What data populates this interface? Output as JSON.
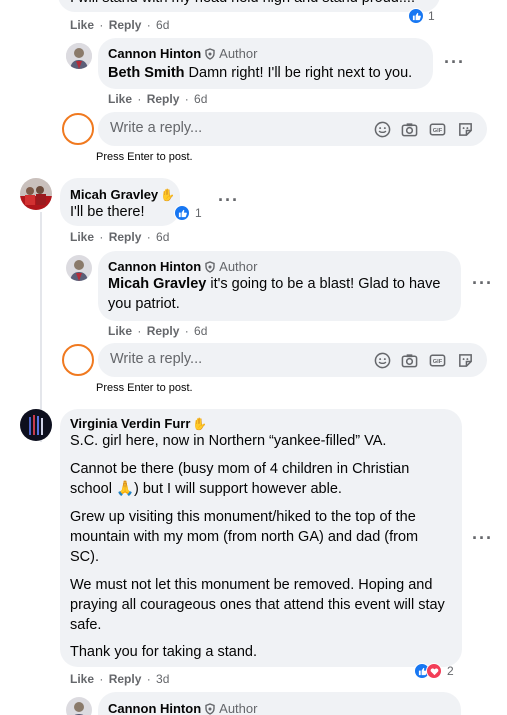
{
  "top_comment": {
    "text_partial": "I will stand with my head held high and stand proud....",
    "reaction_count": "1",
    "actions": {
      "like": "Like",
      "reply": "Reply",
      "time": "6d"
    }
  },
  "reply_1": {
    "author": "Cannon Hinton",
    "badge": "Author",
    "mention": "Beth Smith",
    "text": " Damn right! I'll be right next to you.",
    "actions": {
      "like": "Like",
      "reply": "Reply",
      "time": "6d"
    }
  },
  "reply_box_1": {
    "placeholder": "Write a reply...",
    "hint": "Press Enter to post."
  },
  "comment_micah": {
    "author": "Micah Gravley",
    "text": "I'll be there!",
    "reaction_count": "1",
    "actions": {
      "like": "Like",
      "reply": "Reply",
      "time": "6d"
    }
  },
  "reply_2": {
    "author": "Cannon Hinton",
    "badge": "Author",
    "mention": "Micah Gravley",
    "text": " it's going to be a blast! Glad to have you patriot.",
    "actions": {
      "like": "Like",
      "reply": "Reply",
      "time": "6d"
    }
  },
  "reply_box_2": {
    "placeholder": "Write a reply...",
    "hint": "Press Enter to post."
  },
  "comment_virginia": {
    "author": "Virginia Verdin Furr",
    "paragraphs": [
      "S.C. girl here, now in Northern “yankee-filled” VA.",
      "Cannot be there (busy mom of 4 children in Christian school 🙏) but I will support however able.",
      "Grew up visiting this monument/hiked to the top of the mountain with my mom (from north GA) and dad (from SC).",
      "We must not let this monument be removed. Hoping and praying all courageous ones that attend this event will stay safe.",
      "Thank you for taking a stand."
    ],
    "reaction_count": "2",
    "actions": {
      "like": "Like",
      "reply": "Reply",
      "time": "3d"
    }
  },
  "reply_3": {
    "author": "Cannon Hinton",
    "badge": "Author"
  },
  "colors": {
    "like_blue": "#1877f2",
    "love_red": "#f33e58",
    "annotation_orange": "#f0791f",
    "bubble_gray": "#f0f2f5"
  }
}
